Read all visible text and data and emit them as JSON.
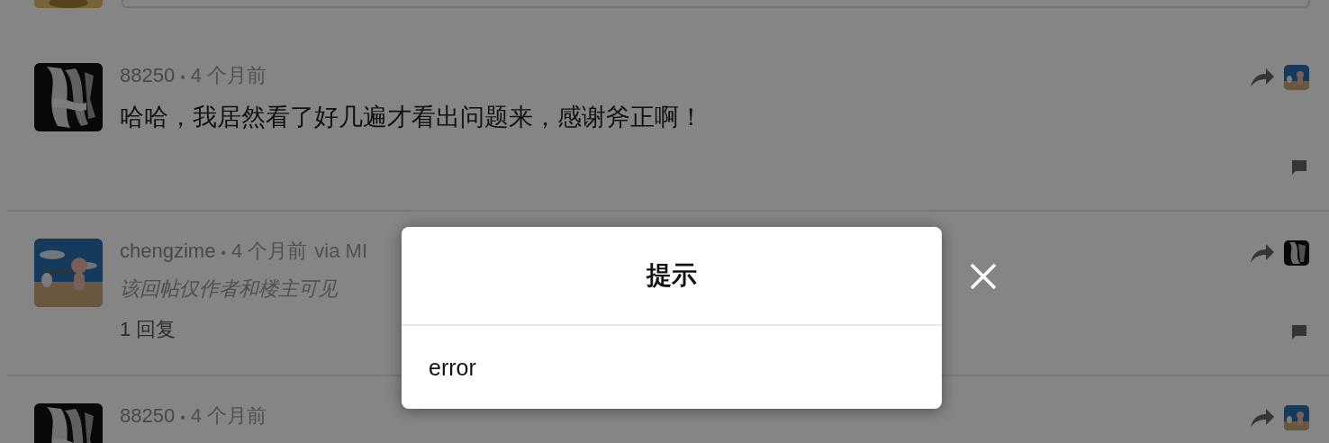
{
  "comments": [
    {
      "author": "88250",
      "separator": "•",
      "time": "4 个月前",
      "content": "哈哈，我居然看了好几遍才看出问题来，感谢斧正啊！",
      "private": false
    },
    {
      "author": "chengzime",
      "separator": "•",
      "time": "4 个月前",
      "via": "via MI",
      "content": "该回帖仅作者和楼主可见",
      "private": true,
      "replies": "1 回复"
    },
    {
      "author": "88250",
      "separator": "•",
      "time": "4 个月前"
    }
  ],
  "dialog": {
    "title": "提示",
    "message": "error"
  }
}
